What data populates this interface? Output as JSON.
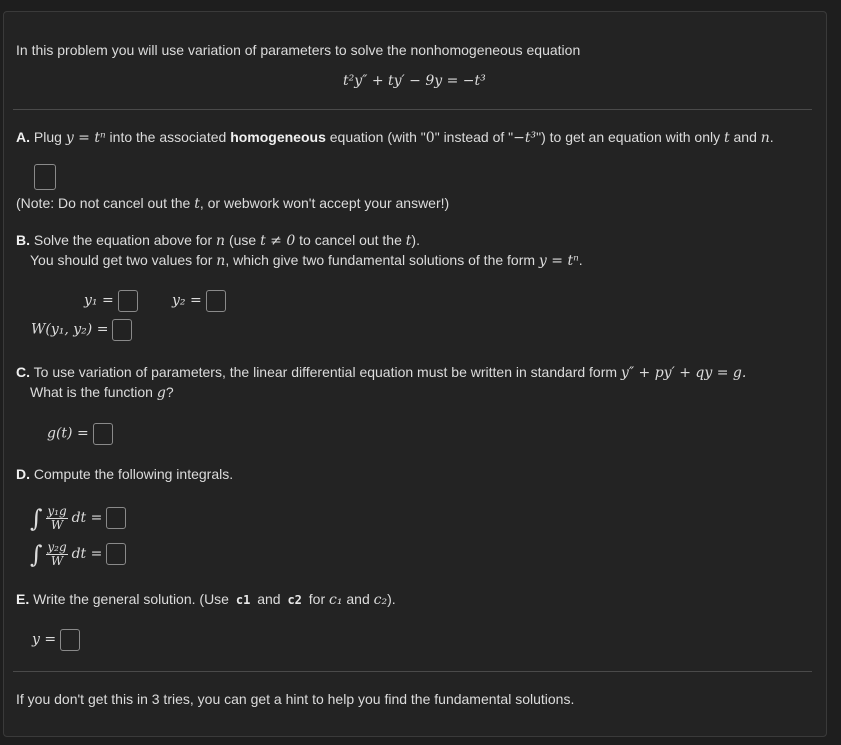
{
  "intro": {
    "text": "In this problem you will use variation of parameters to solve the nonhomogeneous equation",
    "equation": "t²y″ + ty′ − 9y = −t³"
  },
  "part_a": {
    "label": "A.",
    "text_1": "Plug",
    "math_1": "y = tⁿ",
    "text_2": "into the associated",
    "bold": "homogeneous",
    "text_3": "equation (with \"",
    "math_2": "0",
    "text_4": "\" instead of \"",
    "math_3": "−t³",
    "text_5": "\") to get an equation with only",
    "math_4": "t",
    "text_6": "and",
    "math_5": "n",
    "text_7": ".",
    "note_1": "(Note: Do not cancel out the",
    "note_math": "t",
    "note_2": ", or webwork won't accept your answer!)"
  },
  "part_b": {
    "label": "B.",
    "line1_a": "Solve the equation above for",
    "line1_m1": "n",
    "line1_b": "(use",
    "line1_m2": "t ≠ 0",
    "line1_c": "to cancel out the",
    "line1_m3": "t",
    "line1_d": ").",
    "line2_a": "You should get two values for",
    "line2_m1": "n",
    "line2_b": ", which give two fundamental solutions of the form",
    "line2_m2": "y = tⁿ",
    "line2_c": ".",
    "y1_label": "y₁ =",
    "y2_label": "y₂ =",
    "w_label": "W(y₁, y₂) ="
  },
  "part_c": {
    "label": "C.",
    "line1": "To use variation of parameters, the linear differential equation must be written in standard form",
    "line1_math": "y″ + py′ + qy = g.",
    "line2_a": "What is the function",
    "line2_m": "g",
    "line2_b": "?",
    "g_label": "g(t) ="
  },
  "part_d": {
    "label": "D.",
    "text": "Compute the following integrals.",
    "int1_num": "y₁g",
    "int1_den": "W",
    "int2_num": "y₂g",
    "int2_den": "W",
    "dt": "dt ="
  },
  "part_e": {
    "label": "E.",
    "text_1": "Write the general solution. (Use",
    "code_1": "c1",
    "text_2": "and",
    "code_2": "c2",
    "text_3": "for",
    "math_1": "c₁",
    "text_4": "and",
    "math_2": "c₂",
    "text_5": ").",
    "y_label": "y ="
  },
  "footer": {
    "text": "If you don't get this in 3 tries, you can get a hint to help you find the fundamental solutions."
  }
}
